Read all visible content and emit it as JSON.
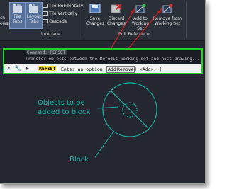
{
  "ribbon": {
    "window_cut_label_1": "ch",
    "window_cut_label_2": "ows",
    "file_tabs": "File Tabs",
    "layout_tabs": "Layout Tabs",
    "tile_horizontally": "Tile Horizontally",
    "tile_vertically": "Tile Vertically",
    "cascade": "Cascade",
    "interface_panel": "Interface",
    "save_changes": "Save Changes",
    "discard_changes": "Discard Changes",
    "add_to_working_set": "Add to Working Set",
    "remove_from_working_set": "Remove from Working Set",
    "edit_reference_panel": "Edit Reference",
    "accent_color": "#cc2222"
  },
  "command_line": {
    "history_line_1": "Command: REFSET",
    "history_line_2": "Transfer objects between the Refedit working set and host drawing...",
    "keyword": "REFSET",
    "prompt": "Enter an option [",
    "option_add": "Add",
    "option_remove": "Remove",
    "prompt_end": "] <Add>: |",
    "highlight_color": "#23d12a"
  },
  "drawing": {
    "annotation_line_1": "Objects to be",
    "annotation_line_2": "added to block",
    "block_label": "Block",
    "entity_color": "#19b2a8"
  }
}
